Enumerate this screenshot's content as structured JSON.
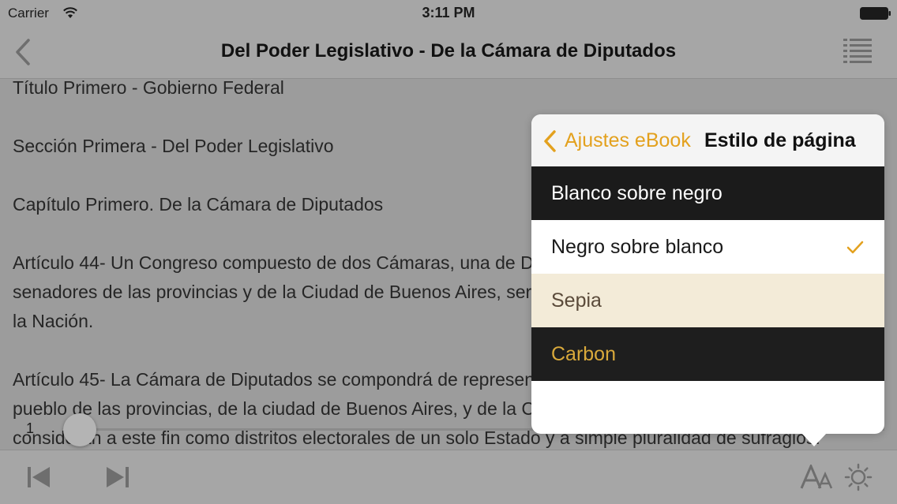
{
  "status": {
    "carrier": "Carrier",
    "time": "3:11 PM"
  },
  "nav": {
    "title": "Del Poder Legislativo - De la Cámara de Diputados"
  },
  "reader": {
    "paragraphs": [
      "Título Primero - Gobierno Federal",
      "Sección Primera - Del Poder Legislativo",
      "Capítulo Primero. De la Cámara de Diputados",
      "Artículo 44- Un Congreso compuesto de dos Cámaras, una de Diputados de la Nación y otra de",
      "senadores de las provincias y de la Ciudad de Buenos Aires, será investido del Poder Legislativo de",
      "la Nación.",
      "Artículo 45- La Cámara de Diputados se compondrá de representantes elegidos directamente por el",
      "pueblo de las provincias, de la ciudad de Buenos Aires, y de la Capital en caso de traslado, que se",
      "consideran a este fin como distritos electorales de un solo Estado y a simple pluralidad de sufragios."
    ]
  },
  "slider": {
    "page_label": "1",
    "progress": 0.0
  },
  "popover": {
    "back_label": "Ajustes eBook",
    "title": "Estilo de página",
    "options": [
      {
        "label": "Blanco sobre negro",
        "selected": false
      },
      {
        "label": "Negro sobre blanco",
        "selected": true
      },
      {
        "label": "Sepia",
        "selected": false
      },
      {
        "label": "Carbon",
        "selected": false
      }
    ]
  },
  "colors": {
    "accent": "#e3a11e",
    "overlay": "#9c9c9c"
  },
  "icons": {
    "back": "chevron-left-icon",
    "toc": "list-icon",
    "prev": "skip-back-icon",
    "next": "skip-forward-icon",
    "font": "font-size-icon",
    "brightness": "sun-icon",
    "check": "checkmark-icon"
  }
}
